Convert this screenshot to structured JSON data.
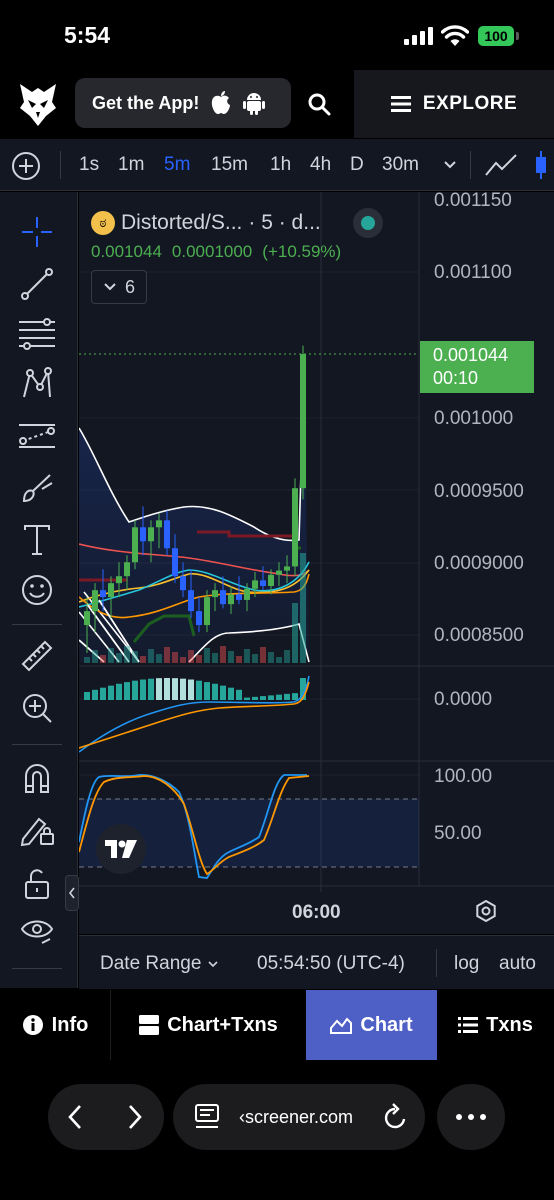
{
  "status_bar": {
    "time": "5:54",
    "battery": "100"
  },
  "header": {
    "get_app_label": "Get the App!",
    "explore_label": "EXPLORE"
  },
  "timeframes": [
    {
      "label": "1s",
      "active": false
    },
    {
      "label": "1m",
      "active": false
    },
    {
      "label": "5m",
      "active": true
    },
    {
      "label": "15m",
      "active": false
    },
    {
      "label": "1h",
      "active": false
    },
    {
      "label": "4h",
      "active": false
    },
    {
      "label": "D",
      "active": false
    },
    {
      "label": "30m",
      "active": false
    }
  ],
  "tools": [
    "crosshair-icon",
    "trend-line-icon",
    "fib-lines-icon",
    "pattern-icon",
    "forecast-icon",
    "brush-icon",
    "text-icon",
    "emoji-icon",
    "ruler-icon",
    "zoom-in-icon",
    "magnet-icon",
    "lock-pencil-icon",
    "lock-icon",
    "eye-icon"
  ],
  "legend": {
    "symbol": "Distorted/S...",
    "interval": "· 5 · d...",
    "last": "0.001044",
    "change": "0.0001000",
    "change_pct": "(+10.59%)",
    "indicator_count": "6"
  },
  "price_axis": {
    "labels": [
      "0.001150",
      "0.001100",
      "0.001000",
      "0.0009500",
      "0.0009000",
      "0.0008500"
    ],
    "current_price": "0.001044",
    "countdown": "00:10"
  },
  "macd_axis": {
    "label": "0.0000"
  },
  "stoch_axis": {
    "labels": [
      "100.00",
      "50.00"
    ]
  },
  "time_axis": {
    "label": "06:00"
  },
  "date_bar": {
    "range_label": "Date Range",
    "clock": "05:54:50 (UTC-4)",
    "log": "log",
    "auto": "auto"
  },
  "tabs": [
    {
      "label": "Info",
      "icon": "info-icon",
      "active": false
    },
    {
      "label": "Chart+Txns",
      "icon": "split-icon",
      "active": false
    },
    {
      "label": "Chart",
      "icon": "mountain-chart-icon",
      "active": true
    },
    {
      "label": "Txns",
      "icon": "list-icon",
      "active": false
    }
  ],
  "browser": {
    "url": "‹screener.com"
  },
  "colors": {
    "up": "#4caf50",
    "down": "#2962ff",
    "accent": "#4e5fc6",
    "panel": "#131722"
  },
  "chart_data": {
    "type": "candlestick",
    "interval": "5m",
    "ylim": [
      0.00082,
      0.00116
    ],
    "ohlc": [
      [
        0.00085,
        0.00087,
        0.00083,
        0.00086
      ],
      [
        0.00086,
        0.00088,
        0.000845,
        0.000875
      ],
      [
        0.000875,
        0.00089,
        0.00086,
        0.00087
      ],
      [
        0.00087,
        0.000885,
        0.000855,
        0.00088
      ],
      [
        0.00088,
        0.000895,
        0.00087,
        0.000885
      ],
      [
        0.000885,
        0.0009,
        0.000875,
        0.000895
      ],
      [
        0.000895,
        0.000925,
        0.00089,
        0.00092
      ],
      [
        0.00092,
        0.000935,
        0.0009,
        0.00091
      ],
      [
        0.00091,
        0.000925,
        0.000895,
        0.00092
      ],
      [
        0.00092,
        0.00093,
        0.000905,
        0.000925
      ],
      [
        0.000925,
        0.000932,
        0.0009,
        0.000905
      ],
      [
        0.000905,
        0.000915,
        0.00088,
        0.000885
      ],
      [
        0.000885,
        0.000895,
        0.00087,
        0.000875
      ],
      [
        0.000875,
        0.00089,
        0.000855,
        0.00086
      ],
      [
        0.00086,
        0.00087,
        0.000845,
        0.00085
      ],
      [
        0.00085,
        0.000875,
        0.000845,
        0.00087
      ],
      [
        0.00087,
        0.00088,
        0.00086,
        0.000875
      ],
      [
        0.000875,
        0.000885,
        0.000862,
        0.000865
      ],
      [
        0.000865,
        0.000878,
        0.000858,
        0.000872
      ],
      [
        0.000872,
        0.000885,
        0.000865,
        0.000868
      ],
      [
        0.000868,
        0.00088,
        0.00086,
        0.000876
      ],
      [
        0.000876,
        0.000888,
        0.00087,
        0.000882
      ],
      [
        0.000882,
        0.000892,
        0.000875,
        0.000878
      ],
      [
        0.000878,
        0.00089,
        0.000872,
        0.000886
      ],
      [
        0.000886,
        0.000895,
        0.000878,
        0.000889
      ],
      [
        0.000889,
        0.0009,
        0.00088,
        0.000892
      ],
      [
        0.000892,
        0.000955,
        0.000885,
        0.000948
      ],
      [
        0.000948,
        0.00105,
        0.00094,
        0.001044
      ]
    ]
  }
}
